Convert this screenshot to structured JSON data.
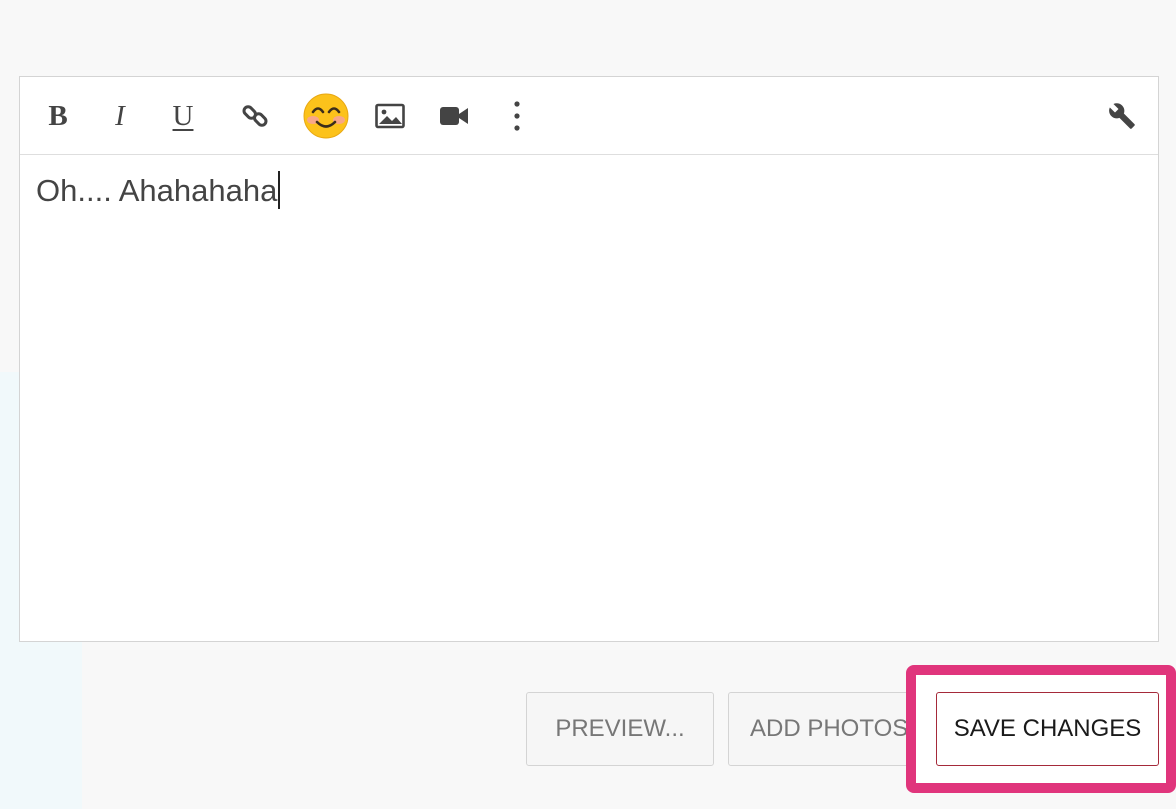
{
  "toolbar": {
    "bold_label": "B",
    "italic_label": "I",
    "underline_label": "U",
    "icons": [
      "link-icon",
      "emoji-icon",
      "image-icon",
      "video-icon",
      "more-vertical-icon",
      "wrench-icon"
    ]
  },
  "editor": {
    "text": "Oh.... Ahahahaha"
  },
  "actions": {
    "preview_label": "PREVIEW...",
    "add_photos_label": "ADD PHOTOS",
    "save_label": "SAVE CHANGES"
  },
  "colors": {
    "highlight": "#e0357c",
    "save_border": "#a52a3a",
    "background": "#f8f8f8"
  }
}
